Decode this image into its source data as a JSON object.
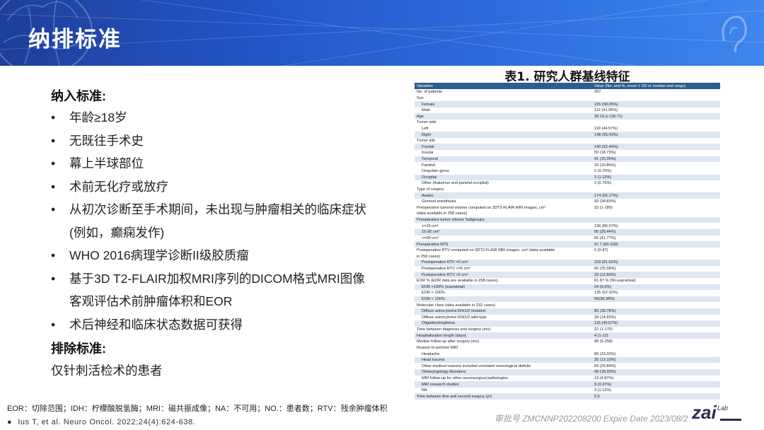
{
  "header": {
    "title": "纳排标准"
  },
  "inclusion": {
    "title": "纳入标准:",
    "bullet": "•",
    "items": [
      "年龄≥18岁",
      "无既往手术史",
      "幕上半球部位",
      "术前无化疗或放疗",
      "从初次诊断至手术期间，未出现与肿瘤相关的临床症状",
      "(例如，癫痫发作)",
      "WHO 2016病理学诊断II级胶质瘤",
      "基于3D T2-FLAIR加权MRI序列的DICOM格式MRI图像",
      "客观评估术前肿瘤体积和EOR",
      "术后神经和临床状态数据可获得"
    ]
  },
  "exclusion": {
    "title": "排除标准:",
    "text": "仅针刺活检术的患者"
  },
  "table": {
    "title": "表1. 研究人群基线特征",
    "headers": [
      "Variables",
      "Value (No. and %, mean ± SD or median and range)"
    ],
    "rows": [
      {
        "label": "No. of patients",
        "value": "267",
        "indent": 0,
        "shade": false
      },
      {
        "label": "Sex",
        "value": "",
        "indent": 0,
        "shade": false
      },
      {
        "label": "Female",
        "value": "155 (58.05%)",
        "indent": 1,
        "shade": true
      },
      {
        "label": "Male",
        "value": "112 (41.95%)",
        "indent": 1,
        "shade": false
      },
      {
        "label": "Age",
        "value": "39.19 yr (18-71)",
        "indent": 0,
        "shade": true
      },
      {
        "label": "Tumor side",
        "value": "",
        "indent": 0,
        "shade": false
      },
      {
        "label": "Left",
        "value": "119 (44.57%)",
        "indent": 1,
        "shade": false
      },
      {
        "label": "Right",
        "value": "148 (55.43%)",
        "indent": 1,
        "shade": true
      },
      {
        "label": "Tumor site",
        "value": "",
        "indent": 0,
        "shade": false
      },
      {
        "label": "Frontal",
        "value": "140 (52.44%)",
        "indent": 1,
        "shade": true
      },
      {
        "label": "Insular",
        "value": "50 (18.73%)",
        "indent": 1,
        "shade": false
      },
      {
        "label": "Temporal",
        "value": "41 (15.35%)",
        "indent": 1,
        "shade": true
      },
      {
        "label": "Parietal",
        "value": "29 (10.86%)",
        "indent": 1,
        "shade": false
      },
      {
        "label": "Cingulate gyrus",
        "value": "2 (0.75%)",
        "indent": 1,
        "shade": false
      },
      {
        "label": "Occipital",
        "value": "3 (1.12%)",
        "indent": 1,
        "shade": true
      },
      {
        "label": "Other (thalamus and parietal-occipital)",
        "value": "2 (0.75%)",
        "indent": 1,
        "shade": false
      },
      {
        "label": "Type of surgery",
        "value": "",
        "indent": 0,
        "shade": false
      },
      {
        "label": "Awake",
        "value": "174 (65.17%)",
        "indent": 1,
        "shade": true
      },
      {
        "label": "General anesthesia",
        "value": "93 (34.83%)",
        "indent": 1,
        "shade": false
      },
      {
        "label": "Preoperative tumoral volume computed on 3DT2-FLAIR MRI images, cm³",
        "value": "15 (1-189)",
        "indent": 0,
        "shade": false
      },
      {
        "label": "(data available in 258 cases)",
        "value": "",
        "indent": 0,
        "shade": false
      },
      {
        "label": "Preoperative tumor volume Subgroups",
        "value": "",
        "indent": 0,
        "shade": true
      },
      {
        "label": "<=15 cm³",
        "value": "136 (86.07%)",
        "indent": 1,
        "shade": false
      },
      {
        "label": "15-30 cm³",
        "value": "56 (35.44%)",
        "indent": 1,
        "shade": true
      },
      {
        "label": ">=30 cm³",
        "value": "66 (41.77%)",
        "indent": 1,
        "shade": false
      },
      {
        "label": "Preoperative KPS",
        "value": "97.7 (50-100)",
        "indent": 0,
        "shade": true
      },
      {
        "label": "Postoperative RTV computed on 3DT2-FLAIR MRI images, cm³ (data available",
        "value": "0 (0-87)",
        "indent": 0,
        "shade": false
      },
      {
        "label": "in 258 cases)",
        "value": "",
        "indent": 0,
        "shade": false
      },
      {
        "label": "Postoperative RTV =0 cm³",
        "value": "159 (61.62%)",
        "indent": 1,
        "shade": true
      },
      {
        "label": "Postoperative RTV <=5 cm³",
        "value": "66 (25.58%)",
        "indent": 1,
        "shade": false
      },
      {
        "label": "Postoperative RTV >5 cm³",
        "value": "33 (12.80%)",
        "indent": 1,
        "shade": true
      },
      {
        "label": "EOR % (EOR data are available in 258 cases)",
        "value": "61.87 % (50-supratotal)",
        "indent": 0,
        "shade": false
      },
      {
        "label": "EOR >100% (supratotal)",
        "value": "24 (9.3%)",
        "indent": 1,
        "shade": true
      },
      {
        "label": "EOR = 100%",
        "value": "135 (52.32%)",
        "indent": 1,
        "shade": false
      },
      {
        "label": "EOR < 100%",
        "value": "99(38.38%)",
        "indent": 1,
        "shade": true
      },
      {
        "label": "Molecular class (data available in 232 cases)",
        "value": "",
        "indent": 0,
        "shade": false
      },
      {
        "label": "Diffuse astrocytoma IDH1/2 mutated",
        "value": "83 (35.78%)",
        "indent": 1,
        "shade": true
      },
      {
        "label": "Diffuse astrocytoma IDH1/2 wild-type",
        "value": "34 (14.65%)",
        "indent": 1,
        "shade": false
      },
      {
        "label": "Oligodendroglioma",
        "value": "115 (49.57%)",
        "indent": 1,
        "shade": true
      },
      {
        "label": "Time between diagnosis and surgery (mo)",
        "value": "22 (1-170)",
        "indent": 0,
        "shade": false
      },
      {
        "label": "Hospitalization length (days)",
        "value": "4 (1-12)",
        "indent": 0,
        "shade": true
      },
      {
        "label": "Median follow-up after surgery (mo)",
        "value": "88 (6-258)",
        "indent": 0,
        "shade": false
      },
      {
        "label": "Reason to perform MRI",
        "value": "",
        "indent": 0,
        "shade": false
      },
      {
        "label": "Headache",
        "value": "89 (33.33%)",
        "indent": 1,
        "shade": false
      },
      {
        "label": "Head trauma",
        "value": "35 (13.10%)",
        "indent": 1,
        "shade": true
      },
      {
        "label": "Other medical reasons included unrelated neurological deficits",
        "value": "69 (25.84%)",
        "indent": 1,
        "shade": false
      },
      {
        "label": "Otolaryngology disorders",
        "value": "49 (18.35%)",
        "indent": 1,
        "shade": true
      },
      {
        "label": "MRI follow-up for other neurosurgical pathologies",
        "value": "13 (4.87%)",
        "indent": 1,
        "shade": false
      },
      {
        "label": "MRI research studies",
        "value": "9 (3.37%)",
        "indent": 1,
        "shade": true
      },
      {
        "label": "NA",
        "value": "3 (1.12%)",
        "indent": 1,
        "shade": false
      },
      {
        "label": "Time between first and second surgery (yr)",
        "value": "5.5",
        "indent": 0,
        "shade": true
      }
    ]
  },
  "footnote": "EOR：切除范围；IDH：柠檬酸脱氢酶；MRI：磁共振成像；NA：不可用；NO.：患者数；RTV：残余肿瘤体积",
  "reference": {
    "bullet": "●",
    "text": "Ius T, et al. Neuro Oncol. 2022;24(4):624-638."
  },
  "approval": "审批号 ZMCNNP202208200 Expire Date 2023/08/2",
  "logo": {
    "text": "zai",
    "lab": "Lab"
  },
  "colors": {
    "header_start": "#1e3f9a",
    "header_end": "#3f86ee",
    "table_header": "#2b5d8d",
    "row_shade": "#dde6f1"
  }
}
